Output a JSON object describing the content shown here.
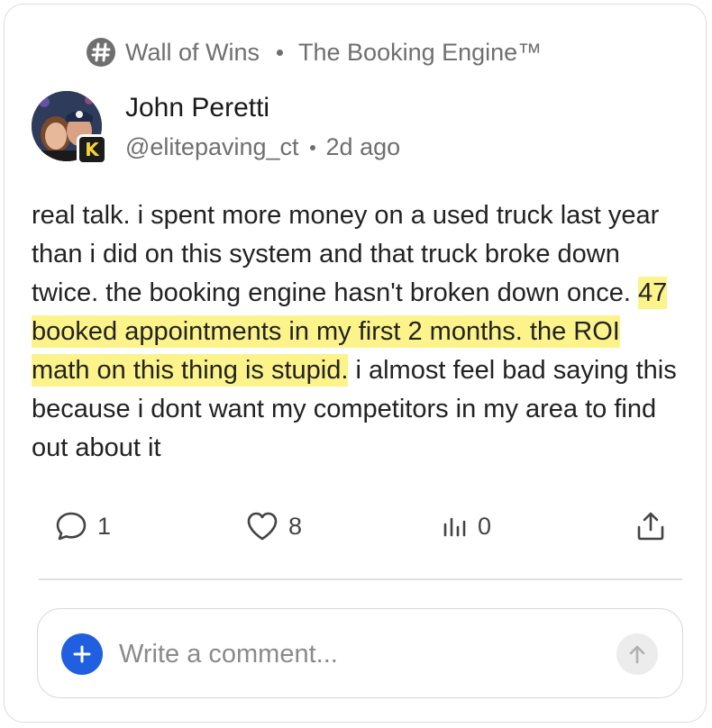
{
  "breadcrumb": {
    "channel": "Wall of Wins",
    "community": "The Booking Engine™",
    "icon": "hash-icon"
  },
  "author": {
    "name": "John Peretti",
    "handle": "@elitepaving_ct",
    "time_ago": "2d ago",
    "badge": "K"
  },
  "post": {
    "text_before": "real talk. i spent more money on a used truck last year than i did on this system and that truck broke down twice. the booking engine hasn't broken down once. ",
    "highlight": "47 booked appointments in my first 2 months. the ROI math on this thing is stupid.",
    "text_after": " i almost feel bad saying this because i dont want my competitors in my area to find out about it"
  },
  "actions": {
    "comments": "1",
    "likes": "8",
    "views": "0"
  },
  "comment": {
    "placeholder": "Write a comment..."
  },
  "colors": {
    "highlight": "#fdf38b",
    "accent": "#1f5fe0",
    "muted_text": "#6f6f6f"
  }
}
